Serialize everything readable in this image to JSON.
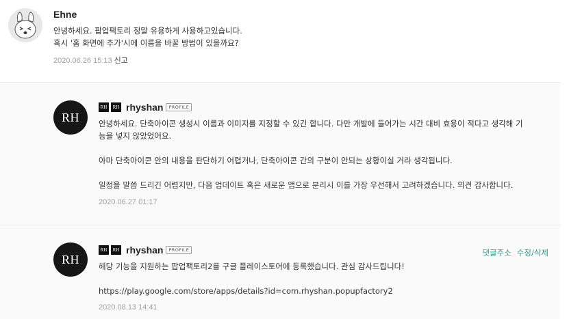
{
  "comments": [
    {
      "author": "Ehne",
      "lines": [
        "안녕하세요. 팝업팩토리 정말 유용하게 사용하고있습니다.",
        "혹시 '홈 화면에 추가'시에 이름을 바꿀 방법이 있을까요?"
      ],
      "date": "2020.06.26 15:13",
      "report_label": "신고"
    },
    {
      "badge_labels": [
        "RH",
        "RH"
      ],
      "avatar_text": "RH",
      "author": "rhyshan",
      "profile_tag": "PROFILE",
      "lines": [
        "안녕하세요. 단축아이콘 생성시 이름과 이미지를 지정할 수 있긴 합니다. 다만 개발에 들어가는 시간 대비 효용이 적다고 생각해 기",
        "능을 넣지 않았었어요.",
        "",
        "아마 단축아이콘 안의 내용을 판단하기 어렵거나, 단축아이콘 간의 구분이 안되는 상황이실 거라 생각됩니다.",
        "",
        "일정을 말씀 드리긴 어렵지만, 다음 업데이트 혹은 새로운 앱으로 분리시 이를 가장 우선해서 고려하겠습니다. 의견 감사합니다."
      ],
      "date": "2020.06.27 01:17"
    },
    {
      "badge_labels": [
        "RH",
        "RH"
      ],
      "avatar_text": "RH",
      "author": "rhyshan",
      "profile_tag": "PROFILE",
      "lines": [
        "해당 기능을 지원하는 팝업팩토리2를 구글 플레이스토어에 등록했습니다. 관심 감사드립니다!",
        "",
        "https://play.google.com/store/apps/details?id=com.rhyshan.popupfactory2"
      ],
      "date": "2020.08.13 14:41",
      "actions": {
        "address_label": "댓글주소",
        "edit_delete_label": "수정/삭제"
      }
    }
  ],
  "colors": {
    "action_teal": "#3a9a8a",
    "meta_gray": "#a0a0a0",
    "avatar_black": "#161616"
  }
}
